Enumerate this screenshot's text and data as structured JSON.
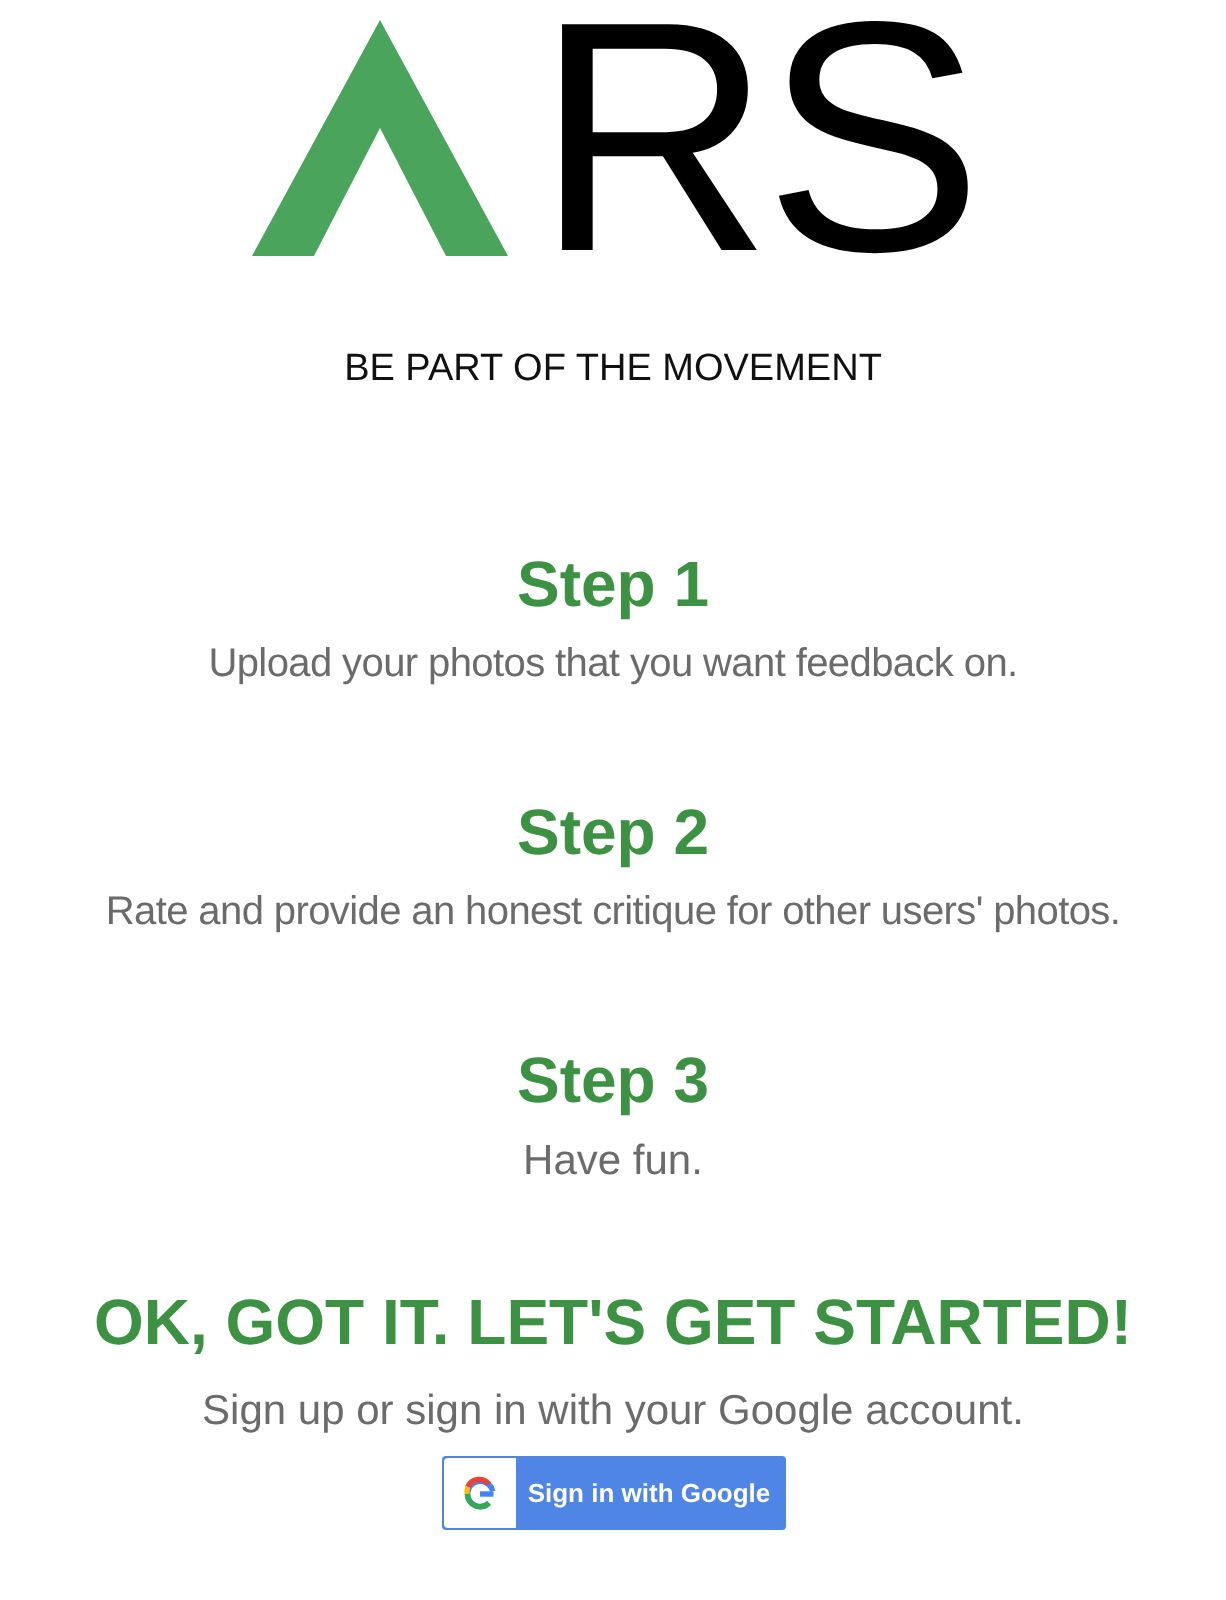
{
  "logo": {
    "text": "RS"
  },
  "tagline": "BE PART OF THE MOVEMENT",
  "steps": [
    {
      "title": "Step 1",
      "description": "Upload your photos that you want feedback on."
    },
    {
      "title": "Step 2",
      "description": "Rate and provide an honest critique for other users' photos."
    },
    {
      "title": "Step 3",
      "description": "Have fun."
    }
  ],
  "cta": {
    "heading": "OK, GOT IT. LET'S GET STARTED!",
    "subtext": "Sign up or sign in with your Google account.",
    "button": "Sign in with Google"
  }
}
